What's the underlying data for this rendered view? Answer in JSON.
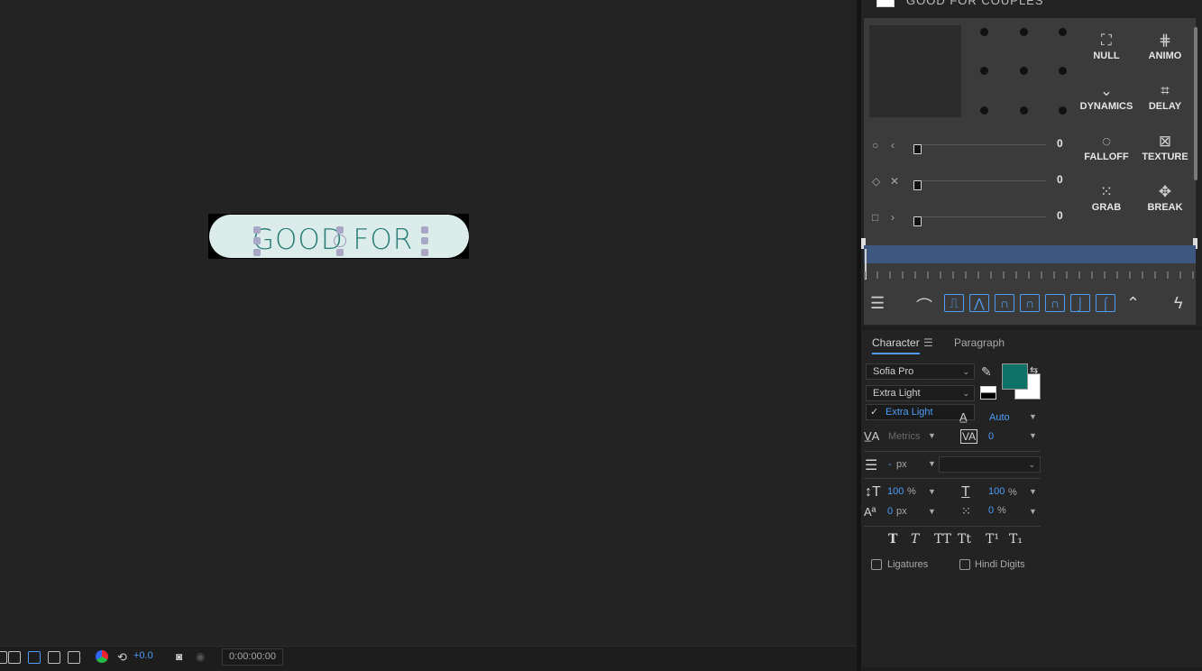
{
  "viewer": {
    "layer_text": "GOOD FOR",
    "exposure": "+0.0",
    "timecode": "0:00:00:00"
  },
  "plugin": {
    "title": "GOOD FOR COUPLES",
    "buttons": [
      {
        "label": "NULL",
        "icon": "null-icon"
      },
      {
        "label": "ANIMO",
        "icon": "animo-icon"
      },
      {
        "label": "DYNAMICS",
        "icon": "dynamics-icon"
      },
      {
        "label": "DELAY",
        "icon": "delay-icon"
      },
      {
        "label": "FALLOFF",
        "icon": "falloff-icon"
      },
      {
        "label": "TEXTURE",
        "icon": "texture-icon"
      },
      {
        "label": "GRAB",
        "icon": "grab-icon"
      },
      {
        "label": "BREAK",
        "icon": "break-icon"
      }
    ],
    "sliders": [
      {
        "value": "0",
        "icons": [
          "circle-icon",
          "chevron-left-icon"
        ]
      },
      {
        "value": "0",
        "icons": [
          "diamond-icon",
          "x-icon"
        ]
      },
      {
        "value": "0",
        "icons": [
          "square-icon",
          "chevron-right-icon"
        ]
      }
    ]
  },
  "character": {
    "tabs": [
      "Character",
      "Paragraph"
    ],
    "font_family": "Sofia Pro",
    "font_style": "Extra Light",
    "menu_item": "Extra Light",
    "fill_color": "#0d7168",
    "leading": "Auto",
    "kerning": "Metrics",
    "tracking": "0",
    "stroke_width": "-",
    "stroke_unit": "px",
    "vertical_scale": "100",
    "vertical_scale_unit": "%",
    "horizontal_scale": "100",
    "horizontal_scale_unit": "%",
    "baseline_shift": "0",
    "baseline_unit": "px",
    "tsume": "0",
    "tsume_unit": "%",
    "font_styles": [
      "T",
      "T",
      "TT",
      "Tt",
      "T¹",
      "T₁"
    ],
    "ligatures": "Ligatures",
    "hindi_digits": "Hindi Digits"
  }
}
